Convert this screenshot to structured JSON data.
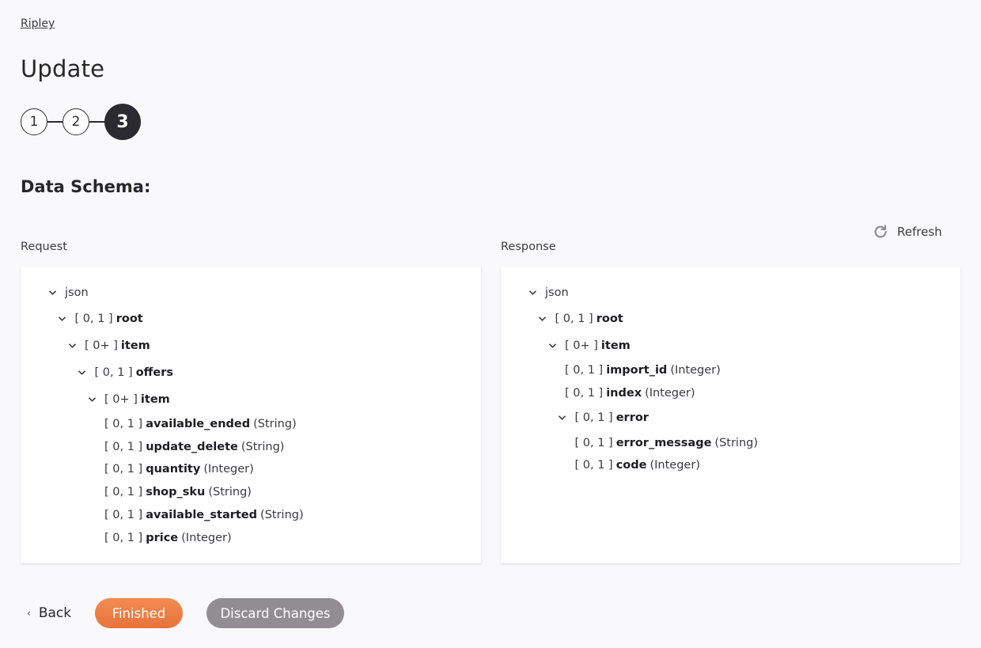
{
  "breadcrumb": "Ripley",
  "page_title": "Update",
  "steps": [
    {
      "label": "1",
      "active": false
    },
    {
      "label": "2",
      "active": false
    },
    {
      "label": "3",
      "active": true
    }
  ],
  "section_title": "Data Schema:",
  "refresh_label": "Refresh",
  "request": {
    "label": "Request",
    "tree": [
      {
        "depth": 0,
        "expandable": true,
        "cardinality": "",
        "name": "json",
        "type": "",
        "plain": true
      },
      {
        "depth": 1,
        "expandable": true,
        "cardinality": "[ 0, 1 ]",
        "name": "root",
        "type": ""
      },
      {
        "depth": 2,
        "expandable": true,
        "cardinality": "[ 0+ ]",
        "name": "item",
        "type": ""
      },
      {
        "depth": 3,
        "expandable": true,
        "cardinality": "[ 0, 1 ]",
        "name": "offers",
        "type": ""
      },
      {
        "depth": 4,
        "expandable": true,
        "cardinality": "[ 0+ ]",
        "name": "item",
        "type": ""
      },
      {
        "depth": 5,
        "expandable": false,
        "cardinality": "[ 0, 1 ]",
        "name": "available_ended",
        "type": "(String)"
      },
      {
        "depth": 5,
        "expandable": false,
        "cardinality": "[ 0, 1 ]",
        "name": "update_delete",
        "type": "(String)"
      },
      {
        "depth": 5,
        "expandable": false,
        "cardinality": "[ 0, 1 ]",
        "name": "quantity",
        "type": "(Integer)"
      },
      {
        "depth": 5,
        "expandable": false,
        "cardinality": "[ 0, 1 ]",
        "name": "shop_sku",
        "type": "(String)"
      },
      {
        "depth": 5,
        "expandable": false,
        "cardinality": "[ 0, 1 ]",
        "name": "available_started",
        "type": "(String)"
      },
      {
        "depth": 5,
        "expandable": false,
        "cardinality": "[ 0, 1 ]",
        "name": "price",
        "type": "(Integer)"
      }
    ]
  },
  "response": {
    "label": "Response",
    "tree": [
      {
        "depth": 0,
        "expandable": true,
        "cardinality": "",
        "name": "json",
        "type": "",
        "plain": true
      },
      {
        "depth": 1,
        "expandable": true,
        "cardinality": "[ 0, 1 ]",
        "name": "root",
        "type": ""
      },
      {
        "depth": 2,
        "expandable": true,
        "cardinality": "[ 0+ ]",
        "name": "item",
        "type": ""
      },
      {
        "depth": 3,
        "expandable": false,
        "cardinality": "[ 0, 1 ]",
        "name": "import_id",
        "type": "(Integer)"
      },
      {
        "depth": 3,
        "expandable": false,
        "cardinality": "[ 0, 1 ]",
        "name": "index",
        "type": "(Integer)"
      },
      {
        "depth": 3,
        "expandable": true,
        "cardinality": "[ 0, 1 ]",
        "name": "error",
        "type": ""
      },
      {
        "depth": 4,
        "expandable": false,
        "cardinality": "[ 0, 1 ]",
        "name": "error_message",
        "type": "(String)"
      },
      {
        "depth": 4,
        "expandable": false,
        "cardinality": "[ 0, 1 ]",
        "name": "code",
        "type": "(Integer)"
      }
    ]
  },
  "footer": {
    "back_label": "Back",
    "finished_label": "Finished",
    "discard_label": "Discard Changes"
  },
  "colors": {
    "accent": "#ee7e45",
    "discard": "#908d93",
    "active_step": "#2a2a2f"
  }
}
